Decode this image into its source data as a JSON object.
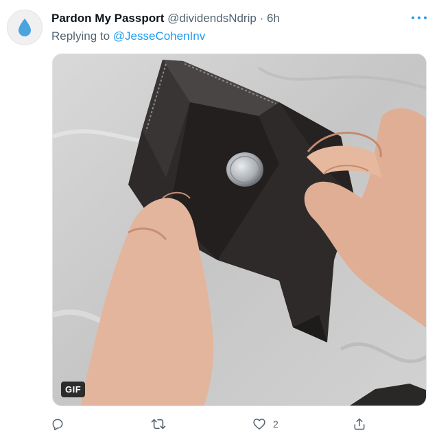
{
  "tweet": {
    "display_name": "Pardon My Passport",
    "handle": "@dividendsNdrip",
    "separator": "·",
    "time": "6h",
    "replying_prefix": "Replying to",
    "replying_to": "@JesseCohenInv"
  },
  "media": {
    "type_badge": "GIF"
  },
  "actions": {
    "reply_count": "",
    "retweet_count": "",
    "like_count": "2",
    "share_count": ""
  },
  "icons": {
    "avatar": "water-drop-icon",
    "more": "more-dots-icon",
    "reply": "reply-icon",
    "retweet": "retweet-icon",
    "like": "heart-icon",
    "share": "share-icon"
  },
  "colors": {
    "accent": "#1d9bf0",
    "avatar_drop": "#4aa3df",
    "secondary_text": "#536471"
  }
}
